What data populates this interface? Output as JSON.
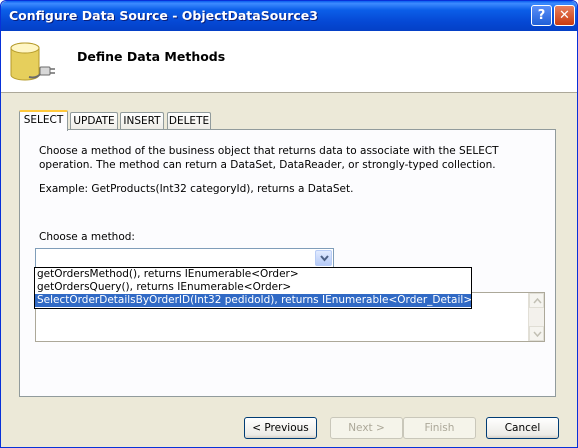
{
  "window": {
    "title": "Configure Data Source - ObjectDataSource3",
    "help_button": "?",
    "close_button": "✕"
  },
  "header": {
    "title": "Define Data Methods",
    "icon": "database-icon"
  },
  "tabs": [
    {
      "label": "SELECT",
      "active": true
    },
    {
      "label": "UPDATE",
      "active": false
    },
    {
      "label": "INSERT",
      "active": false
    },
    {
      "label": "DELETE",
      "active": false
    }
  ],
  "panel": {
    "description": "Choose a method of the business object that returns data to associate with the SELECT operation. The method can return a DataSet, DataReader, or strongly-typed collection.",
    "example": "Example: GetProducts(Int32 categoryId), returns a DataSet.",
    "choose_label": "Choose a method:",
    "combo_value": ""
  },
  "dropdown": {
    "items": [
      "getOrdersMethod(), returns IEnumerable<Order>",
      "getOrdersQuery(), returns IEnumerable<Order>",
      "SelectOrderDetailsByOrderID(Int32 pedidoId), returns IEnumerable<Order_Detail>"
    ],
    "selected_index": 2
  },
  "buttons": {
    "previous": "< Previous",
    "next": "Next >",
    "finish": "Finish",
    "cancel": "Cancel"
  },
  "colors": {
    "titlebar": "#0548d4",
    "selection": "#316ac5",
    "tab_highlight": "#ffc83c"
  }
}
